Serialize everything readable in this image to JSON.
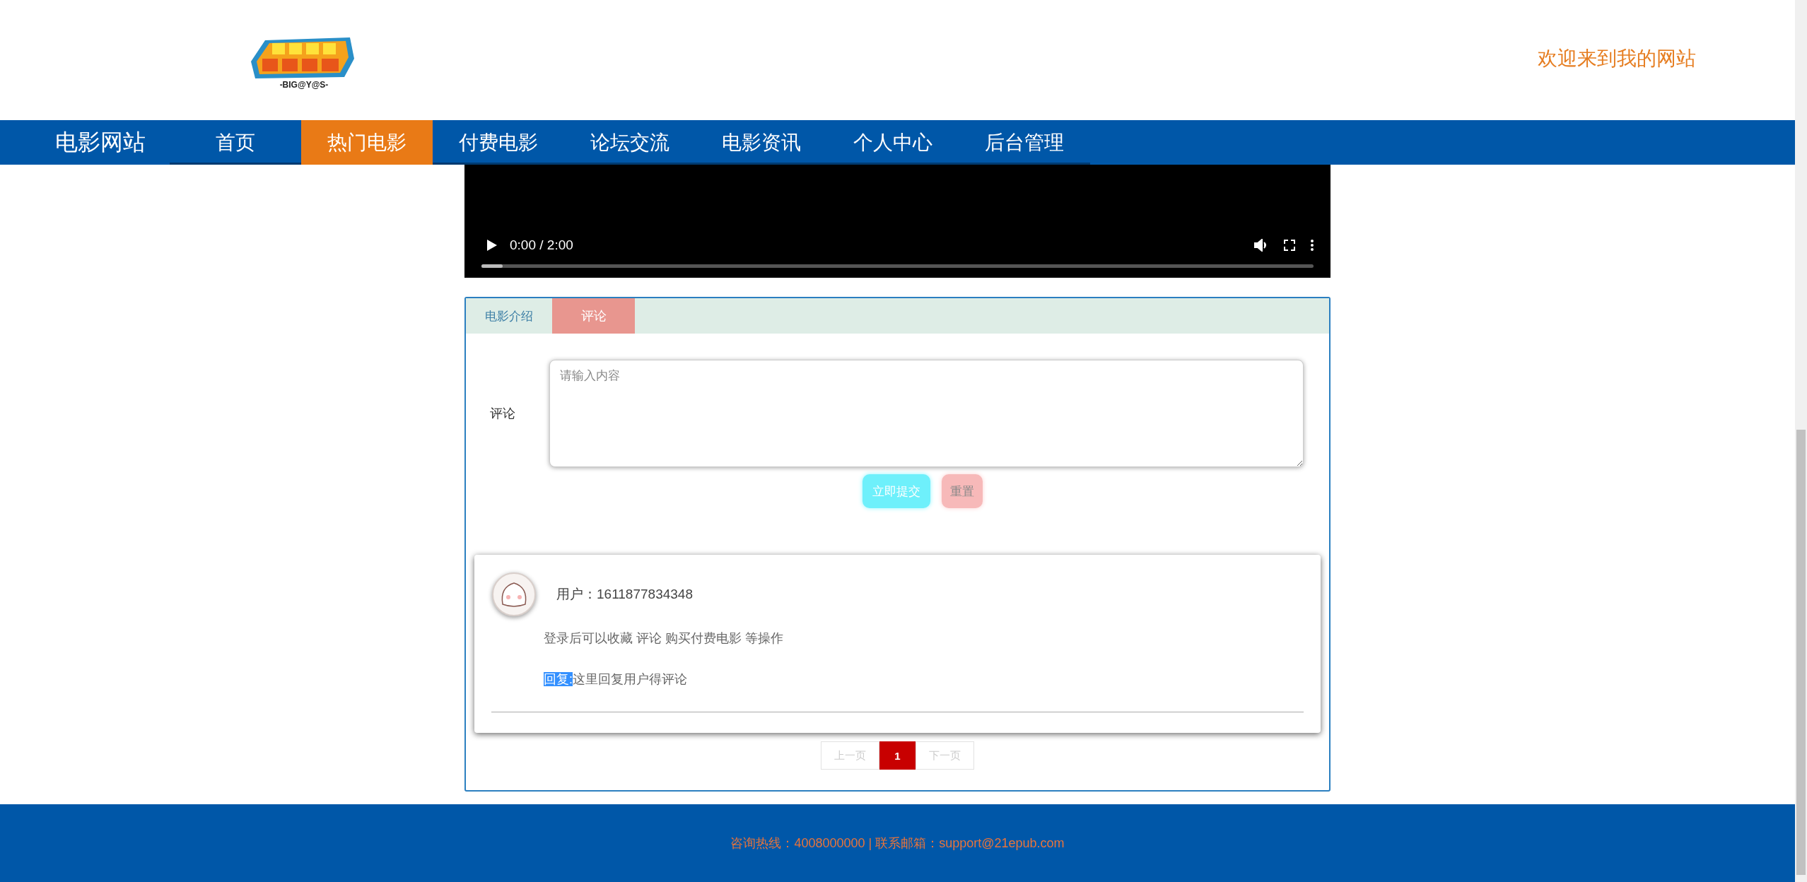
{
  "header": {
    "logo": {
      "subtitle": "-BIG@Y@S-"
    },
    "welcome": "欢迎来到我的网站"
  },
  "nav": {
    "brand": "电影网站",
    "items": [
      {
        "label": "首页",
        "selected": false
      },
      {
        "label": "热门电影",
        "selected": true
      },
      {
        "label": "付费电影",
        "selected": false
      },
      {
        "label": "论坛交流",
        "selected": false
      },
      {
        "label": "电影资讯",
        "selected": false
      },
      {
        "label": "个人中心",
        "selected": false
      },
      {
        "label": "后台管理",
        "selected": false
      }
    ]
  },
  "video": {
    "time": "0:00 / 2:00",
    "level": 0.025
  },
  "panel": {
    "tabs": [
      {
        "label": "电影介绍",
        "selected": false
      },
      {
        "label": "评论",
        "selected": true
      }
    ],
    "form": {
      "label": "评论",
      "placeholder": "请输入内容",
      "buttons": [
        {
          "label": "立即提交",
          "kind": "primary"
        },
        {
          "label": "重置",
          "kind": "reset"
        }
      ]
    },
    "comments": [
      {
        "user": "用户：1611877834348",
        "text": "登录后可以收藏 评论 购买付费电影 等操作",
        "reply_label": "回复:",
        "reply_label_selected": true,
        "reply": "这里回复用户得评论"
      }
    ],
    "pagination": [
      {
        "label": "上一页",
        "disabled": true,
        "selected": false
      },
      {
        "label": "1",
        "disabled": false,
        "selected": true
      },
      {
        "label": "下一页",
        "disabled": true,
        "selected": false
      }
    ]
  },
  "footer": "咨询热线：4008000000 | 联系邮箱：support@21epub.com"
}
